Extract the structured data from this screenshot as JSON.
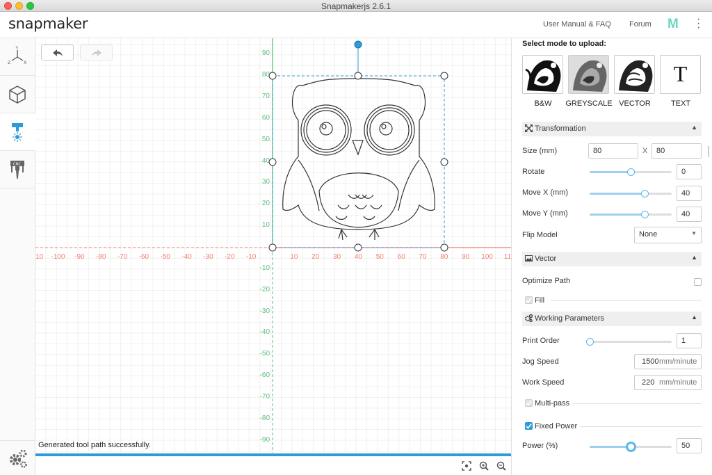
{
  "window": {
    "title": "Snapmakerjs 2.6.1"
  },
  "header": {
    "logo": "snapmaker",
    "links": [
      "User Manual & FAQ",
      "Forum"
    ],
    "brand_mark": "M"
  },
  "sidebar": {
    "items": [
      {
        "icon": "xyz-axes-icon",
        "label": ""
      },
      {
        "icon": "cube-icon",
        "label": ""
      },
      {
        "icon": "laser-icon",
        "label": ""
      },
      {
        "icon": "cnc-icon",
        "label": "CNC"
      }
    ],
    "settings_icon": "gear-icon"
  },
  "canvas": {
    "x_ticks_neg": [
      "-100",
      "-90",
      "-80",
      "-70",
      "-60",
      "-50",
      "-40",
      "-30",
      "-20",
      "-10"
    ],
    "x_ticks_pos": [
      "10",
      "20",
      "30",
      "40",
      "50",
      "60",
      "70",
      "80",
      "90",
      "100"
    ],
    "x_edge_left": "10",
    "x_edge_right": "11",
    "y_ticks_pos": [
      "90",
      "80",
      "70",
      "60",
      "50",
      "40",
      "30",
      "20",
      "10"
    ],
    "y_ticks_neg": [
      "-10",
      "-20",
      "-30",
      "-40",
      "-50",
      "-60",
      "-70",
      "-80",
      "-90"
    ],
    "status": "Generated tool path successfully.",
    "colors": {
      "x_axis": "#f27f6c",
      "y_axis": "#5cc07a",
      "selection": "#2e9bd9"
    }
  },
  "panel": {
    "mode_title": "Select mode to upload:",
    "modes": [
      {
        "label": "B&W"
      },
      {
        "label": "GREYSCALE"
      },
      {
        "label": "VECTOR"
      },
      {
        "label": "TEXT",
        "glyph": "T"
      }
    ],
    "transformation": {
      "title": "Transformation",
      "size_label": "Size (mm)",
      "size_w": "80",
      "size_x": "X",
      "size_h": "80",
      "rotate_label": "Rotate",
      "rotate": "0",
      "move_x_label": "Move X (mm)",
      "move_x": "40",
      "move_y_label": "Move Y (mm)",
      "move_y": "40",
      "flip_label": "Flip Model",
      "flip": "None"
    },
    "vector": {
      "title": "Vector",
      "optimize_label": "Optimize Path",
      "fill_label": "Fill"
    },
    "working": {
      "title": "Working Parameters",
      "print_order_label": "Print Order",
      "print_order": "1",
      "jog_label": "Jog Speed",
      "jog": "1500",
      "jog_unit": "mm/minute",
      "work_label": "Work Speed",
      "work": "220",
      "work_unit": "mm/minute",
      "multipass_label": "Multi-pass",
      "fixed_power_label": "Fixed Power",
      "power_label": "Power (%)",
      "power": "50"
    }
  },
  "sliders": {
    "rotate": 0.5,
    "move_x": 0.67,
    "move_y": 0.67,
    "print_order": 0.0,
    "power": 0.5
  }
}
